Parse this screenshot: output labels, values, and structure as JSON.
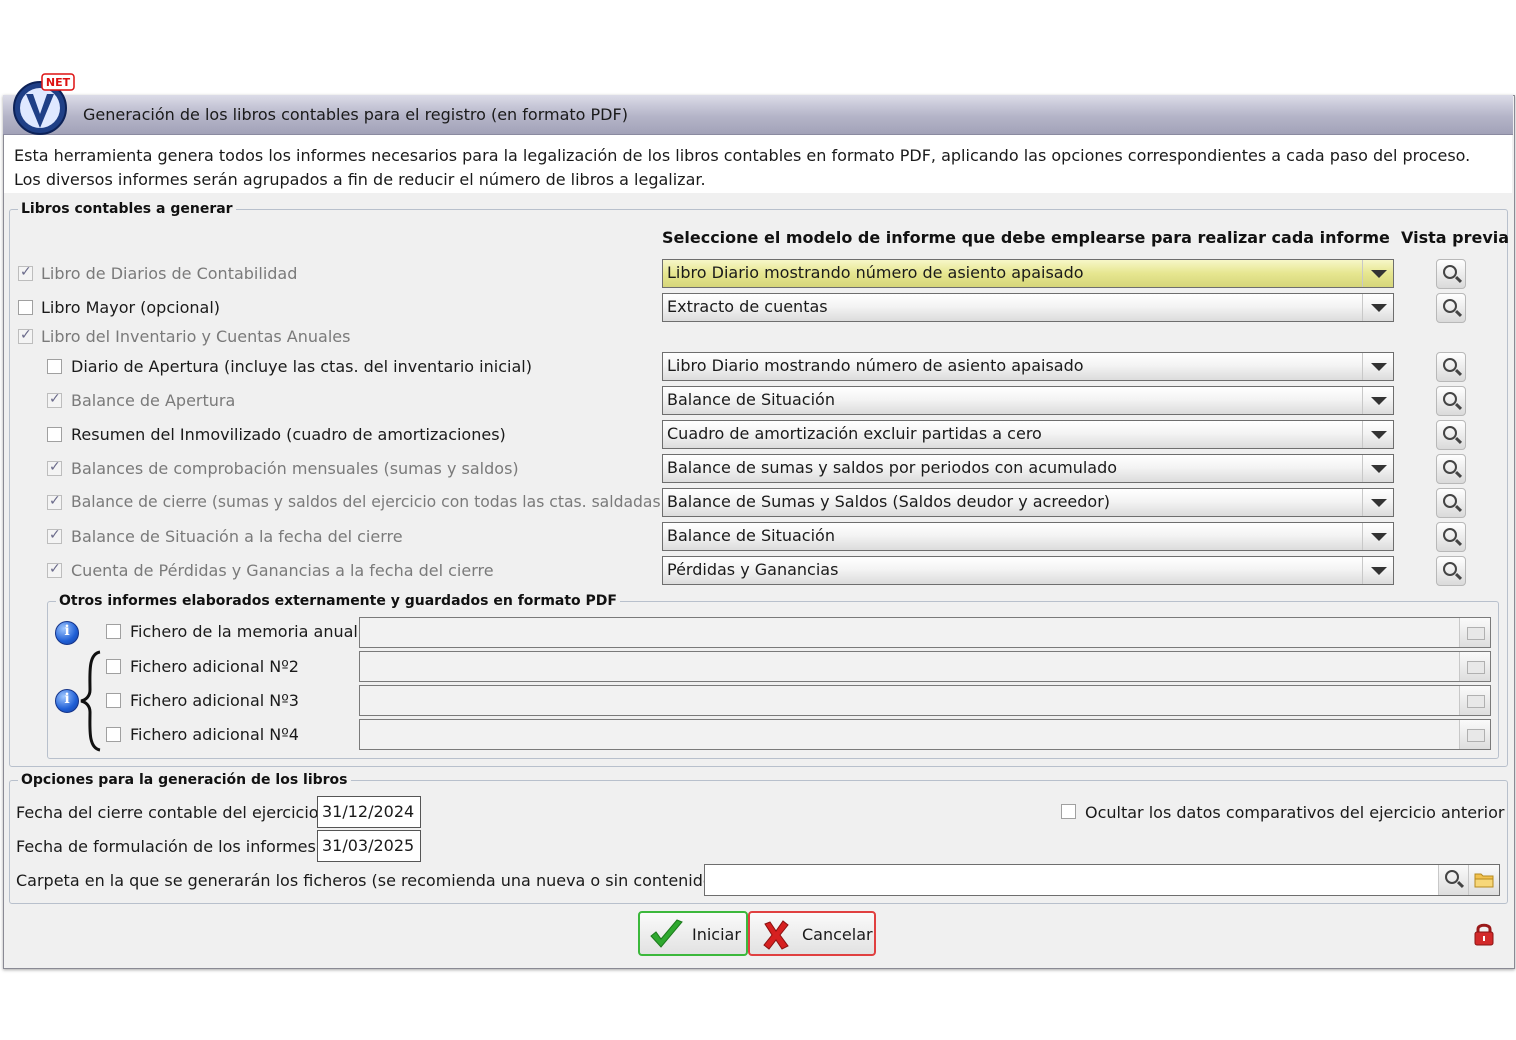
{
  "window": {
    "title": "Generación de los libros contables para el registro (en formato PDF)",
    "logo_badge": "NET"
  },
  "description": {
    "line1": "Esta herramienta genera todos los informes necesarios para la legalización de los libros contables en formato PDF, aplicando las opciones correspondientes a cada paso del proceso.",
    "line2": "Los diversos informes serán agrupados a fin de reducir el número de libros a legalizar."
  },
  "books": {
    "legend": "Libros contables a generar",
    "model_header": "Seleccione el modelo de informe que debe emplearse para realizar cada informe",
    "preview_header": "Vista previa",
    "rows": [
      {
        "label": "Libro de Diarios de Contabilidad",
        "checked": true,
        "enabled": false,
        "model": "Libro Diario mostrando número de asiento apaisado"
      },
      {
        "label": "Libro Mayor (opcional)",
        "checked": false,
        "enabled": true,
        "model": "Extracto de cuentas"
      },
      {
        "label": "Libro del Inventario y Cuentas Anuales",
        "checked": true,
        "enabled": false,
        "model": ""
      },
      {
        "label": "Diario de Apertura (incluye las ctas. del inventario inicial)",
        "checked": false,
        "enabled": true,
        "model": "Libro Diario mostrando número de asiento apaisado"
      },
      {
        "label": "Balance de Apertura",
        "checked": true,
        "enabled": false,
        "model": "Balance de Situación"
      },
      {
        "label": "Resumen del Inmovilizado (cuadro de amortizaciones)",
        "checked": false,
        "enabled": true,
        "model": "Cuadro de amortización excluir partidas a cero"
      },
      {
        "label": "Balances de comprobación mensuales (sumas y saldos)",
        "checked": true,
        "enabled": false,
        "model": "Balance de sumas y saldos por periodos con acumulado"
      },
      {
        "label": "Balance de cierre (sumas y saldos del ejercicio con todas las ctas. saldadas)",
        "checked": true,
        "enabled": false,
        "model": "Balance de Sumas y Saldos (Saldos deudor y acreedor)"
      },
      {
        "label": "Balance de Situación a la fecha del cierre",
        "checked": true,
        "enabled": false,
        "model": "Balance de Situación"
      },
      {
        "label": "Cuenta de Pérdidas y Ganancias a la fecha del cierre",
        "checked": true,
        "enabled": false,
        "model": "Pérdidas y Ganancias"
      }
    ]
  },
  "external": {
    "legend": "Otros informes elaborados externamente y guardados en formato PDF",
    "files": [
      {
        "label": "Fichero de la memoria anual",
        "value": ""
      },
      {
        "label": "Fichero adicional Nº2",
        "value": ""
      },
      {
        "label": "Fichero adicional Nº3",
        "value": ""
      },
      {
        "label": "Fichero adicional Nº4",
        "value": ""
      }
    ]
  },
  "options": {
    "legend": "Opciones para la generación de los libros",
    "close_date_label": "Fecha del cierre contable del ejercicio",
    "close_date": "31/12/2024",
    "formulation_date_label": "Fecha de formulación de los informes",
    "formulation_date": "31/03/2025",
    "hide_comparative_label": "Ocultar los datos comparativos del ejercicio anterior",
    "folder_label": "Carpeta en la que se generarán los ficheros (se recomienda una nueva o sin contenido)",
    "folder_value": ""
  },
  "buttons": {
    "start": "Iniciar",
    "cancel": "Cancelar"
  },
  "colors": {
    "highlight_combo": "#e6e690",
    "titlebar": "#b4b4c8",
    "ok_green": "#2fa82f",
    "cancel_red": "#d62020"
  }
}
